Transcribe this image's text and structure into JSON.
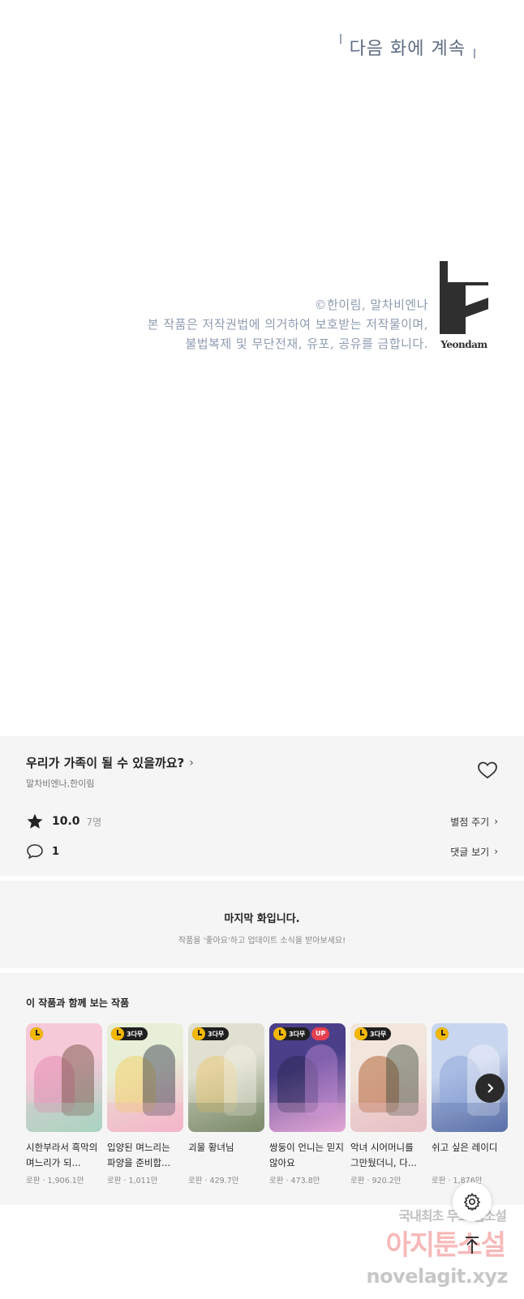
{
  "comic": {
    "next_episode": "다음 화에 계속",
    "copyright_lines": [
      "©한이림, 말차비엔나",
      "본 작품은 저작권법에 의거하여 보호받는 저작물이며,",
      "불법복제 및 무단전재, 유포, 공유를 금합니다."
    ],
    "publisher": "Yeondam"
  },
  "work": {
    "title": "우리가 가족이 될 수 있을까요?",
    "title_chevron": "›",
    "authors": "말차비엔나,한이림",
    "rating": "10.0",
    "rating_count": "7명",
    "rate_link": "별점 주기",
    "comment_count": "1",
    "comment_link": "댓글 보기",
    "link_chevron": "›"
  },
  "last_episode": {
    "title": "마지막 화입니다.",
    "subtitle": "작품을 '좋아요'하고 업데이트 소식을 받아보세요!"
  },
  "recommend": {
    "heading": "이 작품과 함께 보는 작품",
    "items": [
      {
        "title": "시한부라서 흑막의 며느리가 되...",
        "meta": "로판 · 1,906.1만",
        "badge": "",
        "up": "",
        "palette": [
          "#f6c9d8",
          "#e38bb0",
          "#6b4a3a",
          "#a9d4c0"
        ]
      },
      {
        "title": "입양된 며느리는 파양을 준비합...",
        "meta": "로판 · 1,011만",
        "badge": "3다무",
        "up": "",
        "palette": [
          "#e8efd8",
          "#f3d36b",
          "#2c3246",
          "#f4b4c8"
        ]
      },
      {
        "title": "괴물 황녀님",
        "meta": "로판 · 429.7만",
        "badge": "3다무",
        "up": "",
        "palette": [
          "#dfe0d0",
          "#e9c97a",
          "#f4f1e6",
          "#7a8a6a"
        ]
      },
      {
        "title": "쌍둥이 언니는 믿지 않아요",
        "meta": "로판 · 473.8만",
        "badge": "3다무",
        "up": "UP",
        "palette": [
          "#4b3f8a",
          "#2a2a55",
          "#c38ad8",
          "#e3a6d6"
        ]
      },
      {
        "title": "악녀 시어머니를 그만뒀더니, 다...",
        "meta": "로판 · 920.2만",
        "badge": "3다무",
        "up": "",
        "palette": [
          "#f2e6dc",
          "#b4663a",
          "#3a4a3a",
          "#e7c1c5"
        ]
      },
      {
        "title": "쉬고 싶은 레이디",
        "meta": "로판 · 1,876만",
        "badge": "",
        "up": "",
        "palette": [
          "#c9d6ef",
          "#8ea7da",
          "#f2f4fb",
          "#5a6fa8"
        ]
      }
    ]
  },
  "watermark": {
    "line1": "국내최초 무료 웹소설",
    "line2": "아지툰소설",
    "line3": "novelagit.xyz"
  },
  "colors": {
    "accent_gold": "#f2b705",
    "up_red": "#e5404f",
    "panel_bg": "#f5f5f5",
    "next_text": "#5d6b82"
  },
  "icons": [
    "heart-icon",
    "star-icon",
    "comment-icon",
    "chevron-right-icon",
    "clock-icon",
    "gear-icon",
    "arrow-up-icon"
  ]
}
